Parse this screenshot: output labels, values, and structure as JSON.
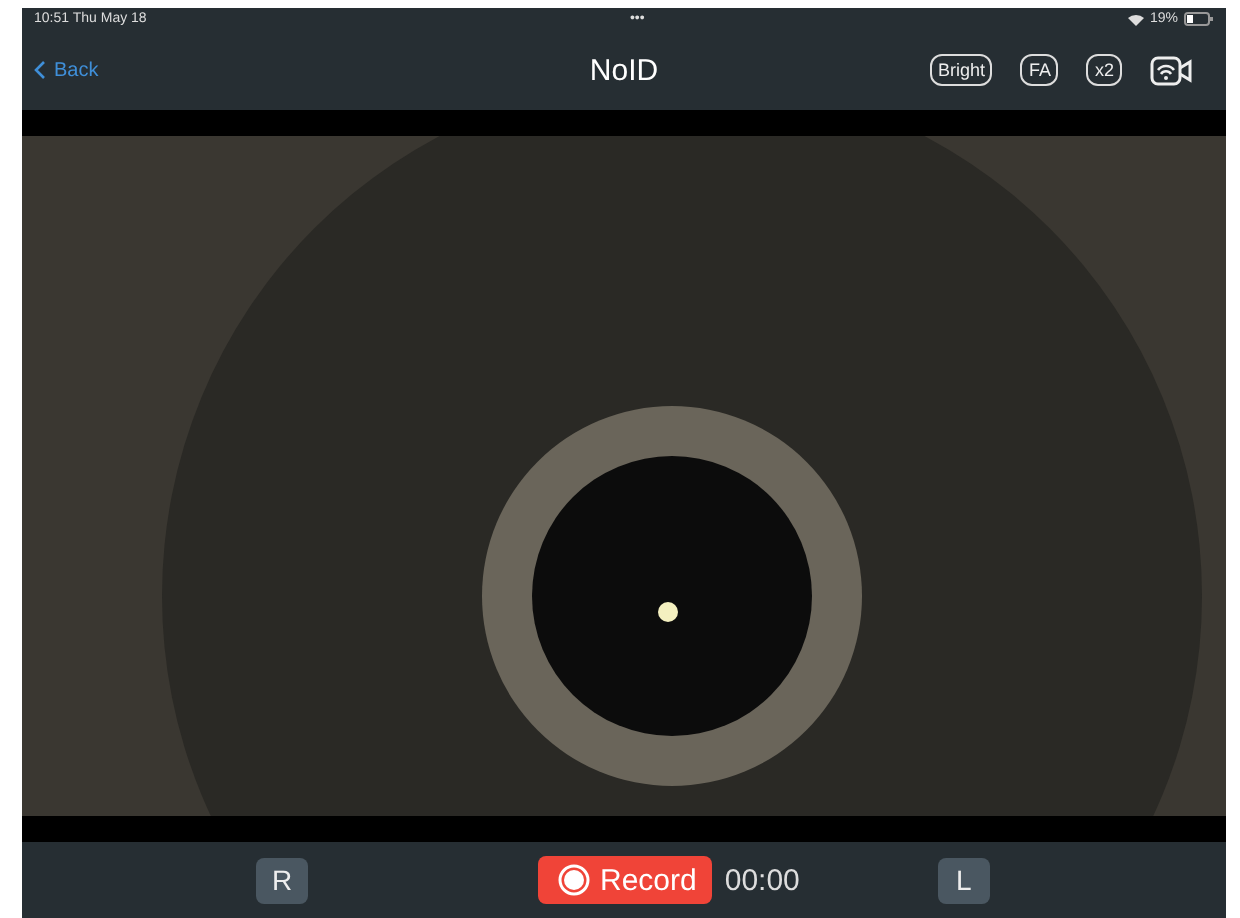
{
  "status_bar": {
    "time": "10:51",
    "date": "Thu May 18",
    "dots": "•••",
    "battery": "19%"
  },
  "nav": {
    "back": "Back",
    "title": "NoID",
    "buttons": [
      "Bright",
      "FA",
      "x2"
    ]
  },
  "controls": {
    "left": "R",
    "record": "Record",
    "timer": "00:00",
    "right": "L"
  }
}
